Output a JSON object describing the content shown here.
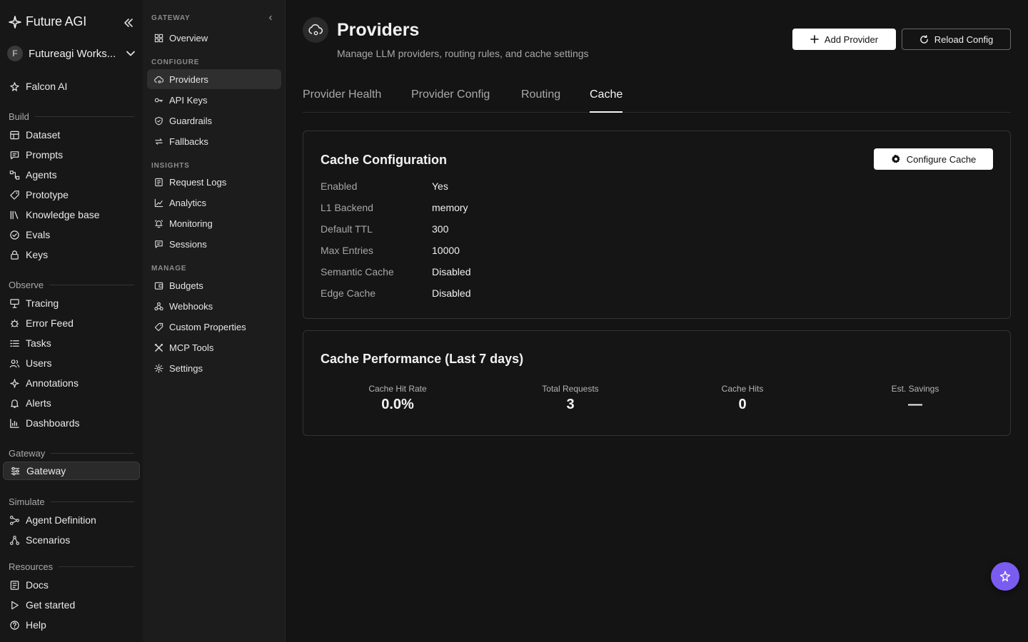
{
  "brand": {
    "name": "Future AGI"
  },
  "workspace": {
    "initial": "F",
    "name": "Futureagi Works..."
  },
  "sidebar": {
    "top_item": "Falcon AI",
    "sections": {
      "build": "Build",
      "observe": "Observe",
      "gateway": "Gateway",
      "simulate": "Simulate",
      "resources": "Resources"
    },
    "build": [
      "Dataset",
      "Prompts",
      "Agents",
      "Prototype",
      "Knowledge base",
      "Evals",
      "Keys"
    ],
    "observe": [
      "Tracing",
      "Error Feed",
      "Tasks",
      "Users",
      "Annotations",
      "Alerts",
      "Dashboards"
    ],
    "gateway": [
      "Gateway"
    ],
    "simulate": [
      "Agent Definition",
      "Scenarios"
    ],
    "resources": [
      "Docs",
      "Get started",
      "Help"
    ]
  },
  "subnav": {
    "heads": {
      "gateway": "GATEWAY",
      "configure": "CONFIGURE",
      "insights": "INSIGHTS",
      "manage": "MANAGE"
    },
    "gateway": [
      "Overview"
    ],
    "configure": [
      "Providers",
      "API Keys",
      "Guardrails",
      "Fallbacks"
    ],
    "insights": [
      "Request Logs",
      "Analytics",
      "Monitoring",
      "Sessions"
    ],
    "manage": [
      "Budgets",
      "Webhooks",
      "Custom Properties",
      "MCP Tools",
      "Settings"
    ]
  },
  "header": {
    "title": "Providers",
    "subtitle": "Manage LLM providers, routing rules, and cache settings",
    "add_label": "Add Provider",
    "reload_label": "Reload Config"
  },
  "tabs": [
    "Provider Health",
    "Provider Config",
    "Routing",
    "Cache"
  ],
  "cache_config": {
    "title": "Cache Configuration",
    "button_label": "Configure Cache",
    "rows": [
      {
        "key": "Enabled",
        "value": "Yes"
      },
      {
        "key": "L1 Backend",
        "value": "memory"
      },
      {
        "key": "Default TTL",
        "value": "300"
      },
      {
        "key": "Max Entries",
        "value": "10000"
      },
      {
        "key": "Semantic Cache",
        "value": "Disabled"
      },
      {
        "key": "Edge Cache",
        "value": "Disabled"
      }
    ]
  },
  "cache_perf": {
    "title": "Cache Performance (Last 7 days)",
    "stats": [
      {
        "label": "Cache Hit Rate",
        "value": "0.0%"
      },
      {
        "label": "Total Requests",
        "value": "3"
      },
      {
        "label": "Cache Hits",
        "value": "0"
      },
      {
        "label": "Est. Savings",
        "value": "—"
      }
    ]
  },
  "colors": {
    "accent": "#7b5cf0",
    "background": "#141414",
    "sidebar": "#171717"
  }
}
